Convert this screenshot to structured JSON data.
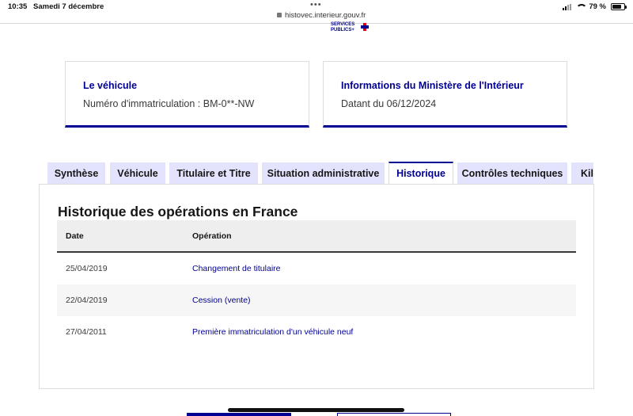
{
  "status_bar": {
    "time": "10:35",
    "date": "Samedi 7 décembre",
    "url": "histovec.interieur.gouv.fr",
    "battery": "79 %",
    "battery_level": 0.79
  },
  "logo": {
    "line1": "SERVICES",
    "line2": "PUBLICS+"
  },
  "cards": {
    "vehicle": {
      "title": "Le véhicule",
      "text": "Numéro d'immatriculation : BM-0**-NW"
    },
    "ministry": {
      "title": "Informations du Ministère de l'Intérieur",
      "text": "Datant du 06/12/2024"
    }
  },
  "tabs": [
    {
      "label": "Synthèse"
    },
    {
      "label": "Véhicule"
    },
    {
      "label": "Titulaire et Titre"
    },
    {
      "label": "Situation administrative"
    },
    {
      "label": "Historique"
    },
    {
      "label": "Contrôles techniques"
    },
    {
      "label": "Kilo"
    }
  ],
  "active_tab": "Historique",
  "history": {
    "title": "Historique des opérations en France",
    "columns": {
      "date": "Date",
      "operation": "Opération"
    },
    "rows": [
      {
        "date": "25/04/2019",
        "operation": "Changement de titulaire"
      },
      {
        "date": "22/04/2019",
        "operation": "Cession (vente)"
      },
      {
        "date": "27/04/2011",
        "operation": "Première immatriculation d'un véhicule neuf"
      }
    ]
  },
  "colors": {
    "accent": "#000091",
    "tab_bg": "#e3e3fd",
    "header_bg": "#eeeeee",
    "row_alt_bg": "#f6f6f6"
  }
}
